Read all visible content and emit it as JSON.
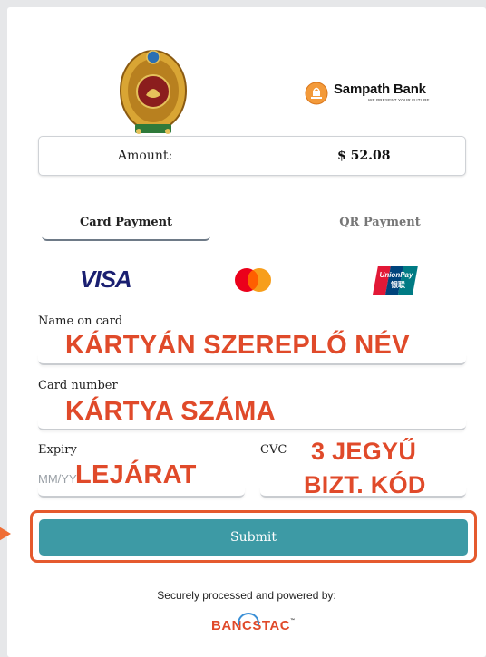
{
  "header": {
    "bank_name": "Sampath Bank",
    "bank_tagline": "WE PRESENT YOUR FUTURE",
    "emblem_icon": "sri-lanka-emblem-icon",
    "bank_logo_icon": "sampath-bank-logo-icon"
  },
  "amount": {
    "label": "Amount:",
    "value": "$ 52.08"
  },
  "tabs": [
    {
      "label": "Card Payment",
      "active": true
    },
    {
      "label": "QR Payment",
      "active": false
    }
  ],
  "card_brands": {
    "visa": "VISA",
    "unionpay": "UnionPay",
    "unionpay_cn": "银联"
  },
  "form": {
    "name_label": "Name on card",
    "name_annotation": "KÁRTYÁN SZEREPLŐ NÉV",
    "number_label": "Card number",
    "number_annotation": "KÁRTYA SZÁMA",
    "expiry_label": "Expiry",
    "expiry_placeholder": "MM/YY",
    "expiry_annotation": "LEJÁRAT",
    "cvc_label": "CVC",
    "cvc_annotation_1": "3 JEGYŰ",
    "cvc_annotation_2": "BIZT. KÓD"
  },
  "submit_label": "Submit",
  "footer": {
    "secure_text": "Securely processed and powered by:",
    "brand": "BANCSTAC",
    "tm": "™"
  },
  "colors": {
    "accent": "#3d9aa5",
    "annotation": "#e04a2a",
    "highlight": "#e55a2e"
  }
}
